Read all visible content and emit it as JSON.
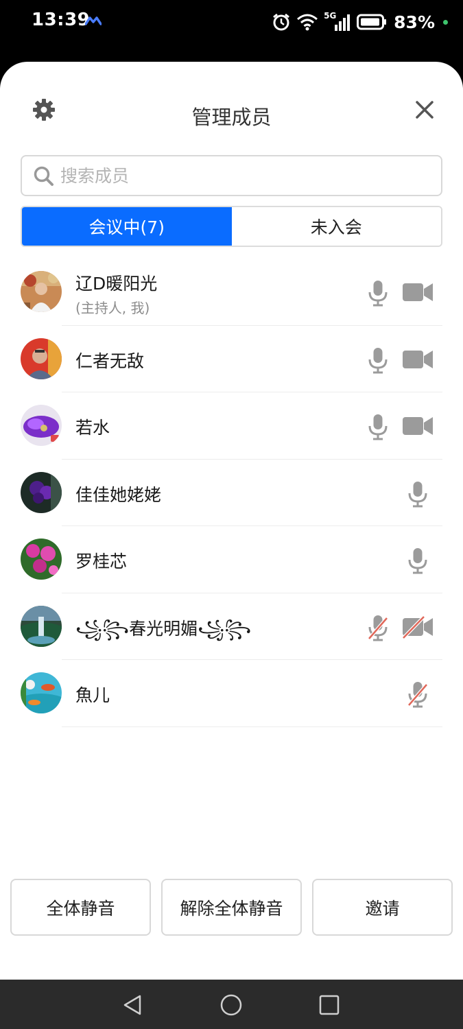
{
  "status_bar": {
    "time": "13:39",
    "battery": "83%",
    "network": "5G",
    "icons": [
      "app-notification-icon",
      "alarm-icon",
      "wifi-icon",
      "signal-icon",
      "battery-icon"
    ]
  },
  "header": {
    "title": "管理成员",
    "left_icon": "gear-icon",
    "right_icon": "close-icon"
  },
  "search": {
    "placeholder": "搜索成员",
    "value": ""
  },
  "tabs": [
    {
      "label": "会议中(7)",
      "active": true
    },
    {
      "label": "未入会",
      "active": false
    }
  ],
  "members": [
    {
      "name": "辽D暖阳光",
      "subtitle": "(主持人, 我)",
      "mic": "on",
      "camera": "on"
    },
    {
      "name": "仁者无敌",
      "subtitle": "",
      "mic": "on",
      "camera": "on"
    },
    {
      "name": "若水",
      "subtitle": "",
      "mic": "on",
      "camera": "on"
    },
    {
      "name": "佳佳她姥姥",
      "subtitle": "",
      "mic": "on",
      "camera": "none"
    },
    {
      "name": "罗桂芯",
      "subtitle": "",
      "mic": "on",
      "camera": "none"
    },
    {
      "name": "꧁꧂春光明媚꧁꧂",
      "subtitle": "",
      "mic": "muted",
      "camera": "off"
    },
    {
      "name": "魚儿",
      "subtitle": "",
      "mic": "muted",
      "camera": "none"
    }
  ],
  "actions": {
    "mute_all": "全体静音",
    "unmute_all": "解除全体静音",
    "invite": "邀请"
  },
  "colors": {
    "accent": "#0a6cff",
    "icon_gray": "#9b9b9b",
    "muted_red": "#e0685a",
    "nav_bg": "#2b2b2b"
  }
}
